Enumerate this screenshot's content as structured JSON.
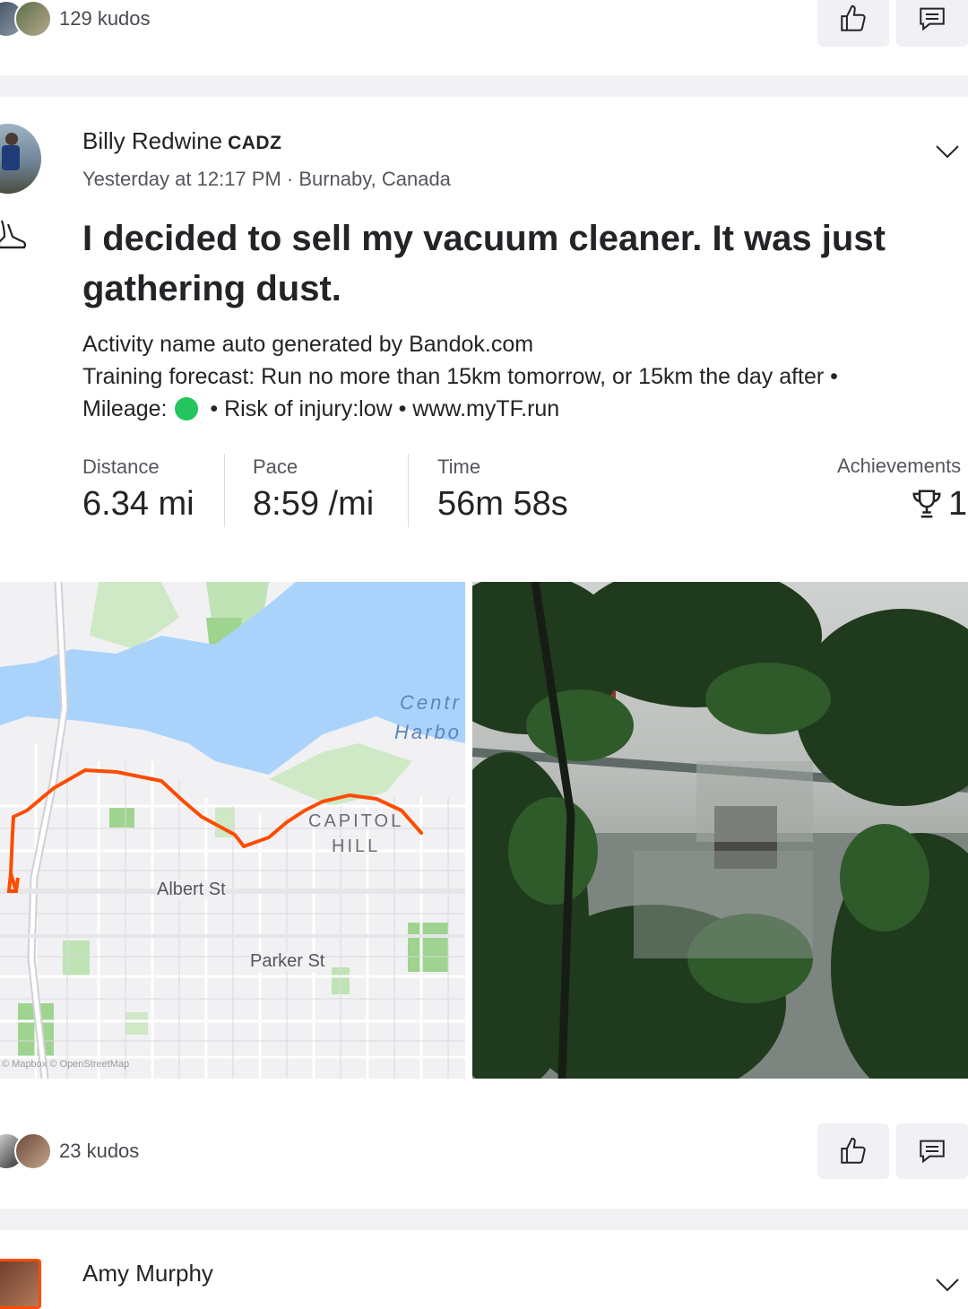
{
  "prev_post": {
    "kudos_text": "129 kudos",
    "like_icon": "thumbs-up-icon",
    "comment_icon": "comment-icon"
  },
  "post": {
    "author": "Billy Redwine",
    "author_badge": "CADZ",
    "meta": "Yesterday at 12:17 PM · Burnaby, Canada",
    "activity_icon": "shoe-icon",
    "menu_icon": "chevron-down-icon",
    "title": "I decided to sell my vacuum cleaner. It was just gathering dust.",
    "description_line1": "Activity name auto generated by Bandok.com",
    "description_line2": "Training forecast: Run no more than 15km tomorrow, or 15km the day after •",
    "mileage_label": "Mileage:",
    "mileage_status_color": "#22c55e",
    "description_line3_rest": "• Risk of injury:low • www.myTF.run",
    "stats": {
      "distance_label": "Distance",
      "distance_value": "6.34 mi",
      "pace_label": "Pace",
      "pace_value": "8:59 /mi",
      "time_label": "Time",
      "time_value": "56m 58s",
      "achievements_label": "Achievements",
      "achievements_value": "1",
      "achievements_icon": "trophy-icon"
    },
    "map": {
      "labels": [
        "Centr",
        "Harbo",
        "CAPITOL",
        "HILL",
        "Albert St",
        "Parker St"
      ],
      "attribution": "© Mapbox © OpenStreetMap",
      "route_color": "#fc4c02",
      "water_color": "#a9d3fb"
    },
    "kudos_text": "23 kudos",
    "like_icon": "thumbs-up-icon",
    "comment_icon": "comment-icon"
  },
  "next_post": {
    "author": "Amy Murphy",
    "menu_icon": "chevron-down-icon"
  }
}
